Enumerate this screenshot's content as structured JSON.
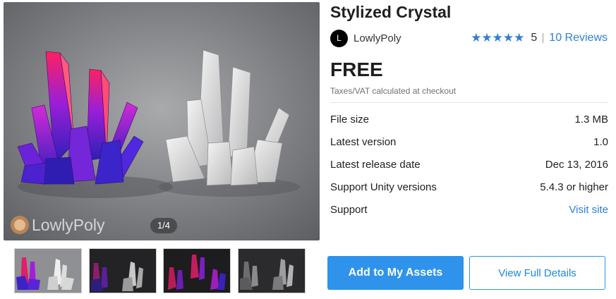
{
  "product": {
    "title": "Stylized Crystal",
    "price": "FREE",
    "tax_note": "Taxes/VAT calculated at checkout"
  },
  "publisher": {
    "avatar_letter": "L",
    "name": "LowlyPoly"
  },
  "rating": {
    "stars": "★★★★★",
    "value": 5,
    "count_label": "5",
    "reviews_label": "10 Reviews"
  },
  "gallery": {
    "watermark": "LowlyPoly",
    "counter": "1/4",
    "thumbnails": [
      {
        "icon": "crystal-thumbnail-1",
        "selected": true
      },
      {
        "icon": "crystal-thumbnail-2",
        "selected": false
      },
      {
        "icon": "crystal-thumbnail-3",
        "selected": false
      },
      {
        "icon": "crystal-thumbnail-4",
        "selected": false
      }
    ]
  },
  "details": [
    {
      "label": "File size",
      "value": "1.3 MB"
    },
    {
      "label": "Latest version",
      "value": "1.0"
    },
    {
      "label": "Latest release date",
      "value": "Dec 13, 2016"
    },
    {
      "label": "Support Unity versions",
      "value": "5.4.3 or higher"
    },
    {
      "label": "Support",
      "value": "Visit site"
    }
  ],
  "actions": {
    "primary": "Add to My Assets",
    "secondary": "View Full Details"
  },
  "colors": {
    "accent": "#2f93ec",
    "link": "#2f7fd6"
  }
}
